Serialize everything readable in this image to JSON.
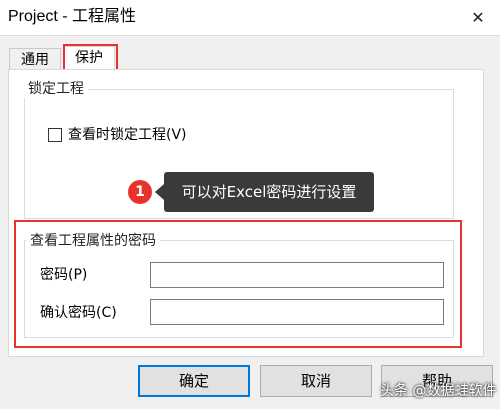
{
  "window": {
    "title": "Project - 工程属性",
    "close_glyph": "✕"
  },
  "tabs": [
    {
      "label": "通用",
      "selected": false
    },
    {
      "label": "保护",
      "selected": true
    }
  ],
  "lock_group": {
    "legend": "锁定工程",
    "checkbox_label": "查看时锁定工程(V)",
    "checked": false
  },
  "annotation": {
    "badge": "1",
    "text": "可以对Excel密码进行设置",
    "highlight_color": "#e8322a"
  },
  "password_group": {
    "legend": "查看工程属性的密码",
    "password_label": "密码(P)",
    "password_value": "",
    "confirm_label": "确认密码(C)",
    "confirm_value": ""
  },
  "buttons": {
    "ok": "确定",
    "cancel": "取消",
    "help": "帮助"
  },
  "watermark": "头条 @数据蛙软件",
  "colors": {
    "accent": "#0078d7",
    "annotation_red": "#e8322a"
  }
}
